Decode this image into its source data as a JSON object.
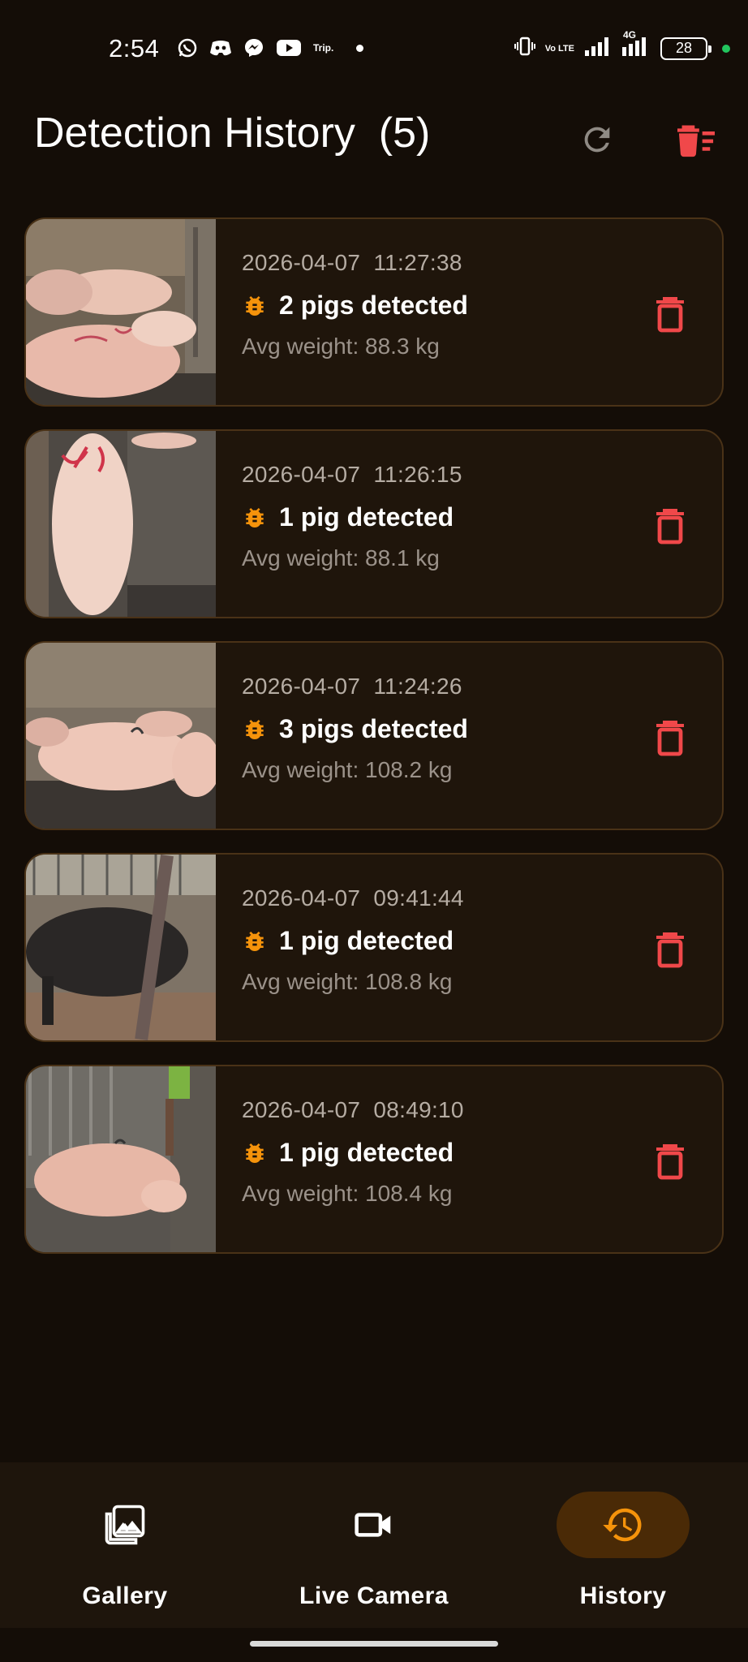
{
  "status_bar": {
    "time": "2:54",
    "notification_icons": [
      "whatsapp-icon",
      "discord-icon",
      "messenger-icon",
      "youtube-icon"
    ],
    "trip_label": "Trip.",
    "volte_label": "Vo LTE",
    "network_label": "4G",
    "battery": "28"
  },
  "app_bar": {
    "title": "Detection History  (5)",
    "refresh_icon": "refresh-icon",
    "clear_all_icon": "delete-sweep-icon"
  },
  "history": [
    {
      "timestamp": "2026-04-07  11:27:38",
      "count_text": "2 pigs detected",
      "avg_weight": "Avg weight: 88.3 kg"
    },
    {
      "timestamp": "2026-04-07  11:26:15",
      "count_text": "1 pig detected",
      "avg_weight": "Avg weight: 88.1 kg"
    },
    {
      "timestamp": "2026-04-07  11:24:26",
      "count_text": "3 pigs detected",
      "avg_weight": "Avg weight: 108.2 kg"
    },
    {
      "timestamp": "2026-04-07  09:41:44",
      "count_text": "1 pig detected",
      "avg_weight": "Avg weight: 108.8 kg"
    },
    {
      "timestamp": "2026-04-07  08:49:10",
      "count_text": "1 pig detected",
      "avg_weight": "Avg weight: 108.4 kg"
    }
  ],
  "bottom_nav": {
    "items": [
      {
        "label": "Gallery",
        "icon": "gallery-icon",
        "active": false
      },
      {
        "label": "Live Camera",
        "icon": "videocam-icon",
        "active": false
      },
      {
        "label": "History",
        "icon": "history-icon",
        "active": true
      }
    ]
  },
  "colors": {
    "background": "#140d07",
    "card": "#1f150b",
    "card_border": "#4a3217",
    "accent_orange": "#f5930b",
    "delete_red": "#f0484a",
    "nav_bg": "#1e150c",
    "active_pill": "#4a2a06"
  }
}
